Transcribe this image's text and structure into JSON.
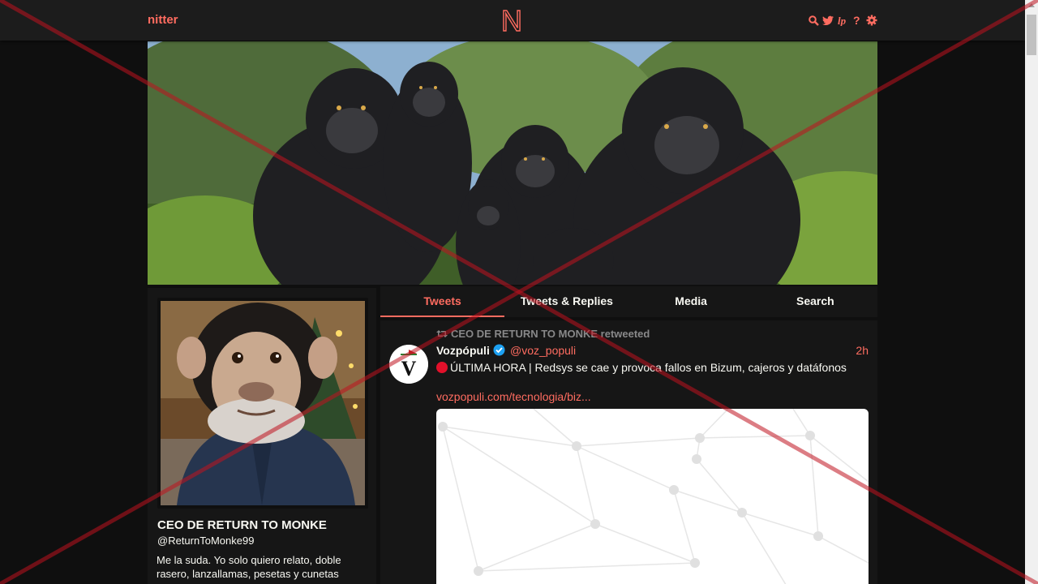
{
  "nav": {
    "brand": "nitter",
    "logo_letter": "N",
    "icons": [
      "search-icon",
      "twitter-icon",
      "rss-icon",
      "help-icon",
      "gear-icon"
    ]
  },
  "profile": {
    "fullname": "CEO DE RETURN TO MONKE",
    "username": "@ReturnToMonke99",
    "bio": "Me la suda. Yo solo quiero relato, doble rasero, lanzallamas, pesetas y cunetas"
  },
  "tabs": [
    {
      "label": "Tweets",
      "active": true
    },
    {
      "label": "Tweets & Replies",
      "active": false
    },
    {
      "label": "Media",
      "active": false
    },
    {
      "label": "Search",
      "active": false
    }
  ],
  "tweet": {
    "retweet_header": "CEO DE RETURN TO MONKE retweeted",
    "fullname": "Vozpópuli",
    "username": "@voz_populi",
    "date": "2h",
    "text": "ÚLTIMA HORA | Redsys se cae y provoca fallos en Bizum, cajeros y datáfonos",
    "link": "vozpopuli.com/tecnologia/biz...",
    "avatar_letter": "V"
  },
  "colors": {
    "accent": "#ff6c60",
    "background": "#0f0f0f",
    "panel": "#161616",
    "navbar": "#1c1c1c"
  }
}
